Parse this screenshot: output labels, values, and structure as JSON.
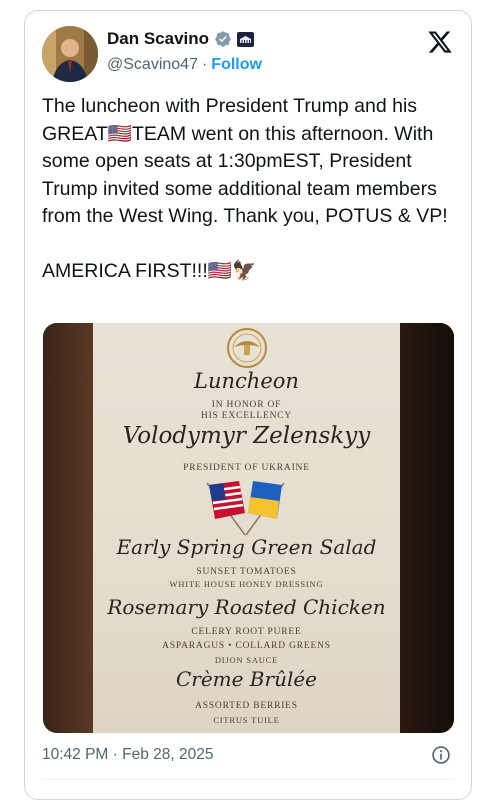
{
  "author": {
    "name": "Dan Scavino",
    "handle": "@Scavino47",
    "separator": "·",
    "follow_label": "Follow"
  },
  "tweet": {
    "text": "The luncheon with President Trump and his GREAT🇺🇸TEAM went on this afternoon. With some open seats at 1:30pmEST, President Trump invited some additional team members from the West Wing. Thank you, POTUS & VP!\n\nAMERICA FIRST!!!🇺🇸🦅",
    "timestamp": "10:42 PM · Feb 28, 2025"
  },
  "menu": {
    "title": "Luncheon",
    "honor_line1": "IN HONOR OF",
    "honor_line2": "HIS EXCELLENCY",
    "guest": "Volodymyr Zelenskyy",
    "guest_title": "PRESIDENT OF UKRAINE",
    "course1": "Early Spring Green Salad",
    "course1_item1": "SUNSET TOMATOES",
    "course1_item2": "WHITE HOUSE HONEY DRESSING",
    "course2": "Rosemary Roasted Chicken",
    "course2_item1": "CELERY ROOT PUREE",
    "course2_item2": "ASPARAGUS • COLLARD GREENS",
    "course2_item3": "DIJON SAUCE",
    "course3": "Crème Brûlée",
    "course3_item1": "ASSORTED BERRIES",
    "course3_item2": "CITRUS TUILE"
  },
  "colors": {
    "accent": "#1d9bf0",
    "text": "#0f1419",
    "muted": "#536471"
  }
}
